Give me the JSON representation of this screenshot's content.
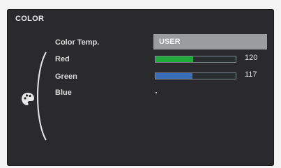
{
  "window": {
    "title": "COLOR"
  },
  "menu": {
    "items": [
      {
        "label": "Color Temp.",
        "value": "USER"
      },
      {
        "label": "Red",
        "value": "120",
        "level": 120,
        "max": 255,
        "color": "#1faa3a"
      },
      {
        "label": "Green",
        "value": "117",
        "level": 117,
        "max": 255,
        "color": "#3a6cb8"
      },
      {
        "label": "Blue"
      }
    ],
    "category_icon": "color-palette-icon"
  }
}
